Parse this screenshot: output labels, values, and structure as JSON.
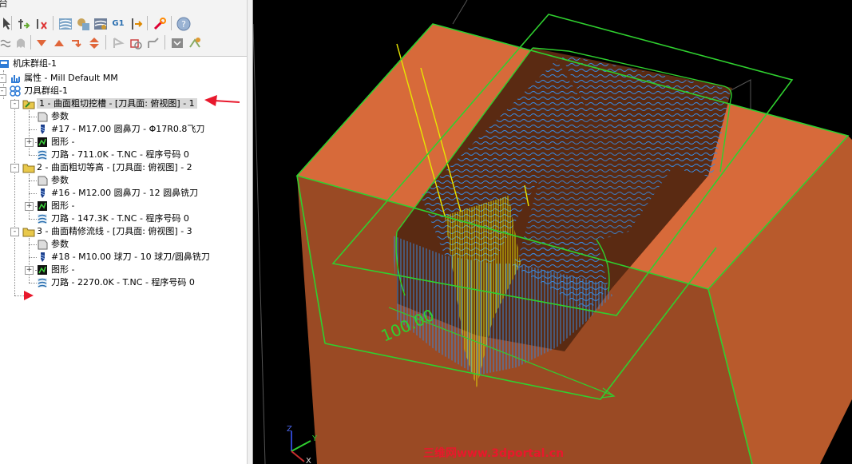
{
  "toolbar": {
    "g1_label": "G1",
    "top_left_glyph": "台"
  },
  "tree": {
    "items": [
      {
        "label": "机床群组-1",
        "icon": "machine-group-icon"
      },
      {
        "label": "属性 - Mill Default MM",
        "icon": "properties-icon"
      },
      {
        "label": "刀具群组-1",
        "icon": "toolpath-group-icon"
      },
      {
        "label": "1 - 曲面粗切挖槽 - [刀具面: 俯视图] - 1",
        "icon": "operation-folder-icon"
      },
      {
        "label": "参数",
        "icon": "parameters-icon"
      },
      {
        "label": "#17 - M17.00 圆鼻刀 - Φ17R0.8飞刀",
        "icon": "tool-icon"
      },
      {
        "label": "图形 -",
        "icon": "geometry-icon"
      },
      {
        "label": "刀路 - 711.0K - T.NC - 程序号码 0",
        "icon": "toolpath-icon"
      },
      {
        "label": "2 - 曲面粗切等高 - [刀具面: 俯视图] - 2",
        "icon": "operation-folder-icon"
      },
      {
        "label": "参数",
        "icon": "parameters-icon"
      },
      {
        "label": "#16 - M12.00 圆鼻刀 - 12 圆鼻铣刀",
        "icon": "tool-icon"
      },
      {
        "label": "图形 -",
        "icon": "geometry-icon"
      },
      {
        "label": "刀路 - 147.3K - T.NC - 程序号码 0",
        "icon": "toolpath-icon"
      },
      {
        "label": "3 - 曲面精修流线 - [刀具面: 俯视图] - 3",
        "icon": "operation-folder-icon"
      },
      {
        "label": "参数",
        "icon": "parameters-icon"
      },
      {
        "label": "#18 - M10.00 球刀 - 10 球刀/圆鼻铣刀",
        "icon": "tool-icon"
      },
      {
        "label": "图形 -",
        "icon": "geometry-icon"
      },
      {
        "label": "刀路 - 2270.0K - T.NC - 程序号码 0",
        "icon": "toolpath-icon"
      }
    ]
  },
  "viewport": {
    "dimension_label": "100.00",
    "axis_labels": {
      "x": "X",
      "y": "Y",
      "z": "Z"
    }
  },
  "watermark": "三维网www.3dportal.cn",
  "colors": {
    "stock": "#d76a3a",
    "stock_side": "#9a4a24",
    "toolpath": "#3a86d8",
    "boundary": "#2fd02f",
    "highlight": "#e8e600",
    "arrow": "#e8182c"
  }
}
